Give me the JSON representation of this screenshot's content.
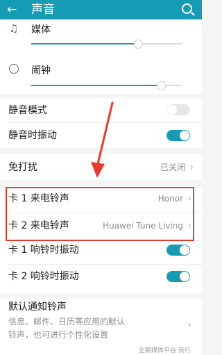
{
  "header": {
    "title": "声音",
    "back_icon": "arrow-left-icon",
    "search_icon": "search-icon"
  },
  "volume": {
    "media": {
      "label": "媒体",
      "icon": "music-note-icon",
      "level": 0.71
    },
    "alarm": {
      "label": "闹钟",
      "icon": "alarm-clock-icon",
      "level": 0.86
    }
  },
  "settings": {
    "silent_mode": {
      "label": "静音模式",
      "on": false
    },
    "vibrate_silent": {
      "label": "静音时振动",
      "on": true
    },
    "dnd": {
      "label": "免打扰",
      "value": "已关闭"
    },
    "ringtone1": {
      "label": "卡 1 来电铃声",
      "value": "Honor"
    },
    "ringtone2": {
      "label": "卡 2 来电铃声",
      "value": "Huawei Tune Living"
    },
    "vibrate1": {
      "label": "卡 1 响铃时振动",
      "on": true
    },
    "vibrate2": {
      "label": "卡 2 响铃时振动",
      "on": true
    },
    "notification": {
      "label": "默认通知铃声",
      "desc": "信息、邮件、日历等应用的默认铃声，也可进行个性化设置"
    }
  },
  "watermark": {
    "text": "企鹅媒体平台 良行"
  },
  "colors": {
    "accent": "#179bb4",
    "annotation": "#e53b2c"
  }
}
